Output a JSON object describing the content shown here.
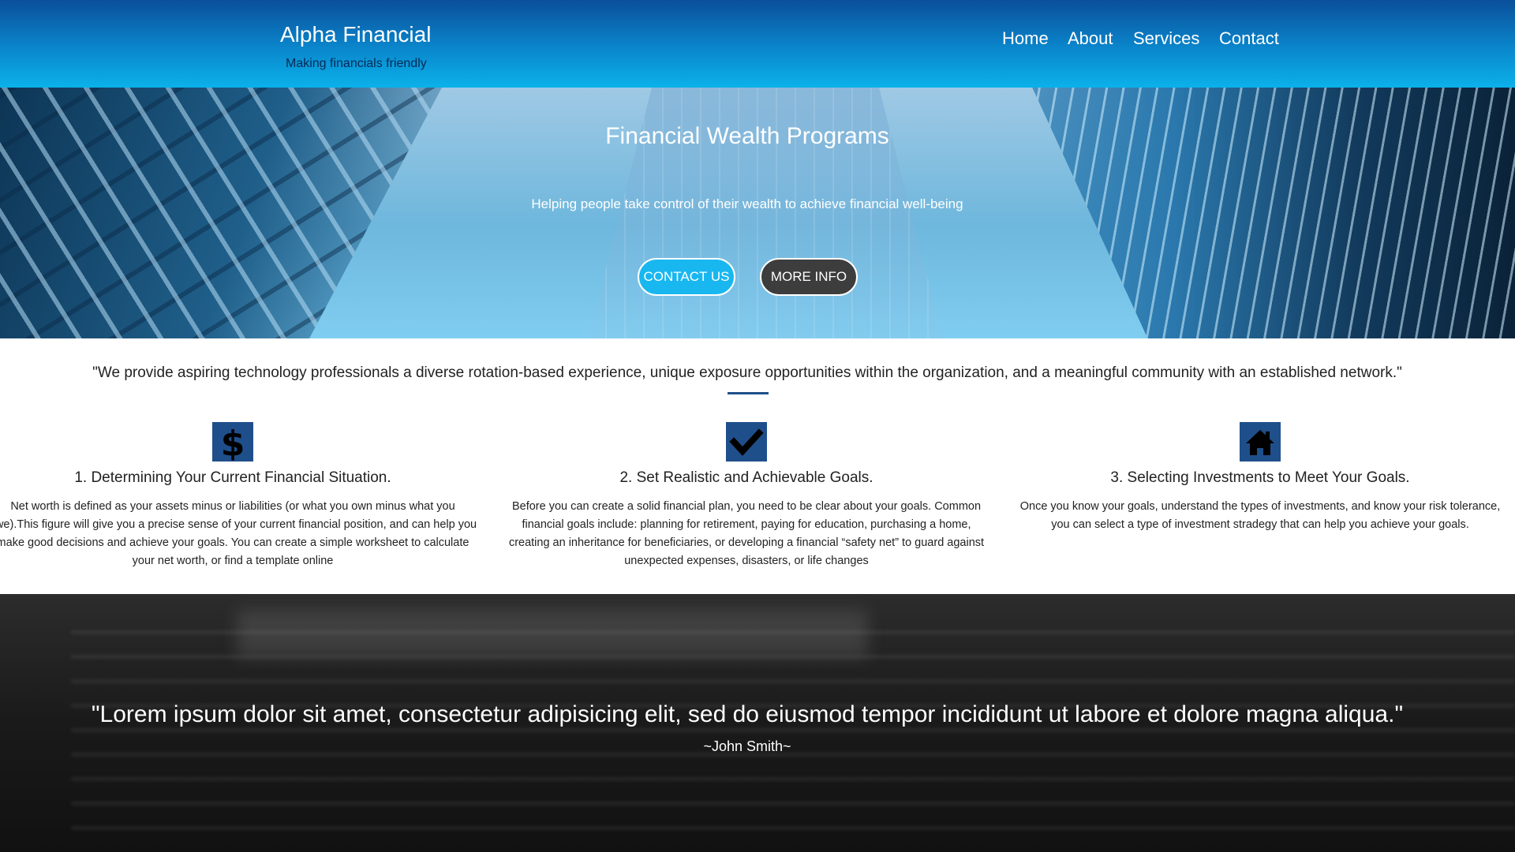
{
  "header": {
    "brand_title": "Alpha Financial",
    "brand_tagline": "Making financials friendly",
    "nav": [
      "Home",
      "About",
      "Services",
      "Contact"
    ]
  },
  "hero": {
    "title": "Financial Wealth Programs",
    "subtitle": "Helping people take control of their wealth to achieve financial well-being",
    "contact_button": "CONTACT US",
    "more_info_button": "MORE INFO"
  },
  "intro": {
    "mission": "\"We provide aspiring technology professionals a diverse rotation-based experience, unique exposure opportunities within the organization, and a meaningful community with an established network.\""
  },
  "steps": [
    {
      "icon": "dollar-icon",
      "title": "1. Determining Your Current Financial Situation.",
      "description": "Net worth is defined as your assets minus or liabilities (or what you own minus what you owe).This figure will give you a precise sense of your current financial position, and can help you make good decisions and achieve your goals. You can create a simple worksheet to calculate your net worth, or find a template online"
    },
    {
      "icon": "checkmark-icon",
      "title": "2. Set Realistic and Achievable Goals.",
      "description": "Before you can create a solid financial plan, you need to be clear about your goals. Common financial goals include: planning for retirement, paying for education, purchasing a home, creating an inheritance for beneficiaries, or developing a financial “safety net” to guard against unexpected expenses, disasters, or life changes"
    },
    {
      "icon": "home-icon",
      "title": "3. Selecting Investments to Meet Your Goals.",
      "description": "Once you know your goals, understand the types of investments, and know your risk tolerance, you can select a type of investment stradegy that can help you achieve your goals."
    }
  ],
  "testimonial": {
    "quote": "\"Lorem ipsum dolor sit amet, consectetur adipisicing elit, sed do eiusmod tempor incididunt ut labore et dolore magna aliqua.\"",
    "author": "~John Smith~"
  },
  "colors": {
    "header_top": "#0a4f9a",
    "header_bottom": "#0bb1ea",
    "contact_button": "#19b7f0",
    "more_info_button": "#3d3d3d",
    "icon_box": "#1f4f8a",
    "divider": "#1f4f8a"
  }
}
